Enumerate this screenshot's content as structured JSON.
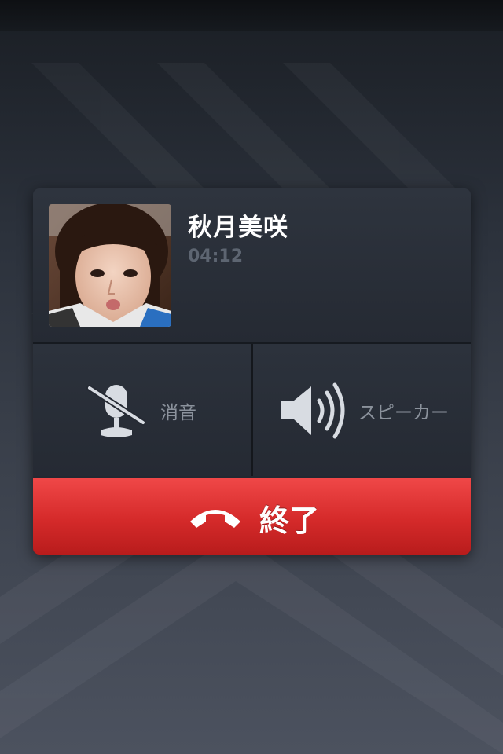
{
  "caller": {
    "name": "秋月美咲",
    "duration": "04:12"
  },
  "controls": {
    "mute_label": "消音",
    "speaker_label": "スピーカー"
  },
  "end_call": {
    "label": "終了"
  },
  "icons": {
    "mute": "microphone-muted-icon",
    "speaker": "speaker-icon",
    "hangup": "phone-hangup-icon"
  },
  "colors": {
    "end_call_red": "#d52a2a",
    "panel_bg": "#232831",
    "duration_text": "#5d6571",
    "control_label": "#8b929c"
  }
}
